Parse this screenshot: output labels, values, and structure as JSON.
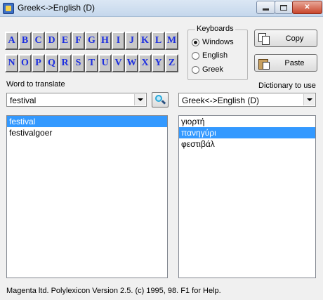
{
  "window": {
    "title": "Greek<->English (D)",
    "close_label": "✕"
  },
  "letters": [
    "A",
    "B",
    "C",
    "D",
    "E",
    "F",
    "G",
    "H",
    "I",
    "J",
    "K",
    "L",
    "M",
    "N",
    "O",
    "P",
    "Q",
    "R",
    "S",
    "T",
    "U",
    "V",
    "W",
    "X",
    "Y",
    "Z"
  ],
  "keyboards": {
    "legend": "Keyboards",
    "options": [
      "Windows",
      "English",
      "Greek"
    ],
    "selected": "Windows"
  },
  "buttons": {
    "copy": "Copy",
    "paste": "Paste"
  },
  "word_label": "Word to translate",
  "dictionary_label": "Dictionary to use",
  "word_input": {
    "value": "festival"
  },
  "dictionary_select": {
    "value": "Greek<->English (D)"
  },
  "word_list": {
    "items": [
      "festival",
      "festivalgoer"
    ],
    "selected": "festival"
  },
  "translation_list": {
    "items": [
      "γιορτή",
      "πανηγύρι",
      "φεστιβάλ"
    ],
    "selected": "πανηγύρι"
  },
  "status": "Magenta ltd. Polylexicon  Version 2.5. (c) 1995, 98. F1 for Help.",
  "colors": {
    "letter_text": "#1d2fe0",
    "selection": "#3399ff"
  }
}
